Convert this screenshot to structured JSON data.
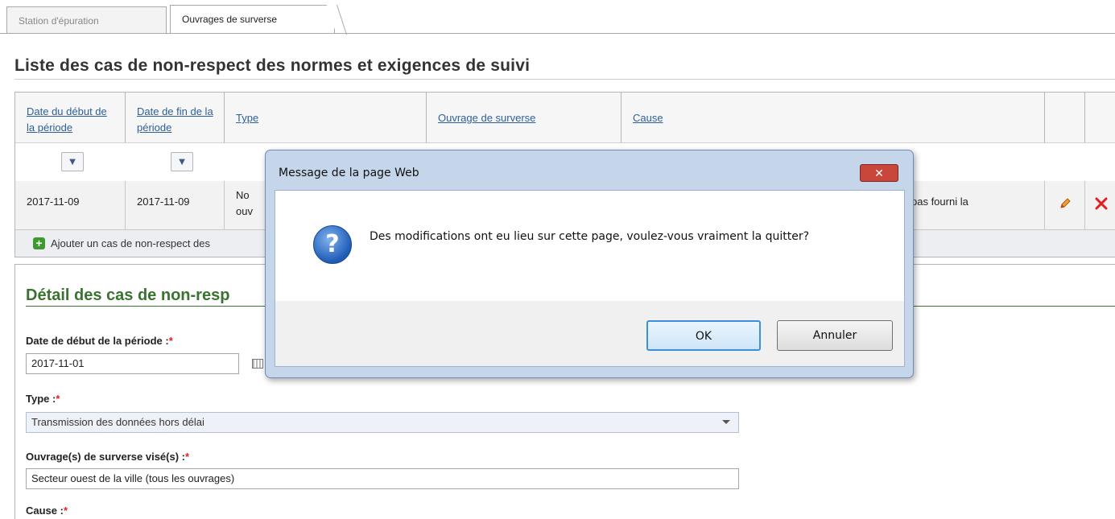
{
  "tabs": [
    {
      "label": "Station d'épuration",
      "active": false
    },
    {
      "label": "Ouvrages de surverse",
      "active": true
    }
  ],
  "list": {
    "title": "Liste des cas de non-respect des normes et exigences de suivi",
    "columns": {
      "start_date": "Date du début de la période",
      "end_date": "Date de fin de la période",
      "type": "Type",
      "overflow_structure": "Ouvrage de surverse",
      "cause": "Cause"
    },
    "row": {
      "start_date": "2017-11-09",
      "end_date": "2017-11-09",
      "type_partial": "No",
      "type_partial_2": "ouv",
      "cause_partial": "pas fourni la"
    },
    "add_label": "Ajouter un cas de non-respect des"
  },
  "detail": {
    "title": "Détail des cas de non-resp",
    "start_label": "Date de début de la période :",
    "start_value": "2017-11-01",
    "type_label": "Type :",
    "type_value": "Transmission des données hors délai",
    "structures_label": "Ouvrage(s) de surverse visé(s) :",
    "structures_value": "Secteur ouest de la ville (tous les ouvrages)",
    "cause_label": "Cause :",
    "required_mark": "*"
  },
  "dialog": {
    "title": "Message de la page Web",
    "close_glyph": "✕",
    "icon_glyph": "?",
    "message": "Des modifications ont eu lieu sur cette page, voulez-vous vraiment la quitter?",
    "ok_label": "OK",
    "cancel_label": "Annuler"
  },
  "icons": {
    "filter": "filter-icon",
    "edit": "pencil-icon",
    "delete": "delete-x-icon",
    "add": "plus-icon",
    "calendar": "calendar-icon"
  },
  "colors": {
    "link": "#2d5f9a",
    "section_title": "#3a7330",
    "required": "#e02020",
    "delete": "#e02020"
  }
}
